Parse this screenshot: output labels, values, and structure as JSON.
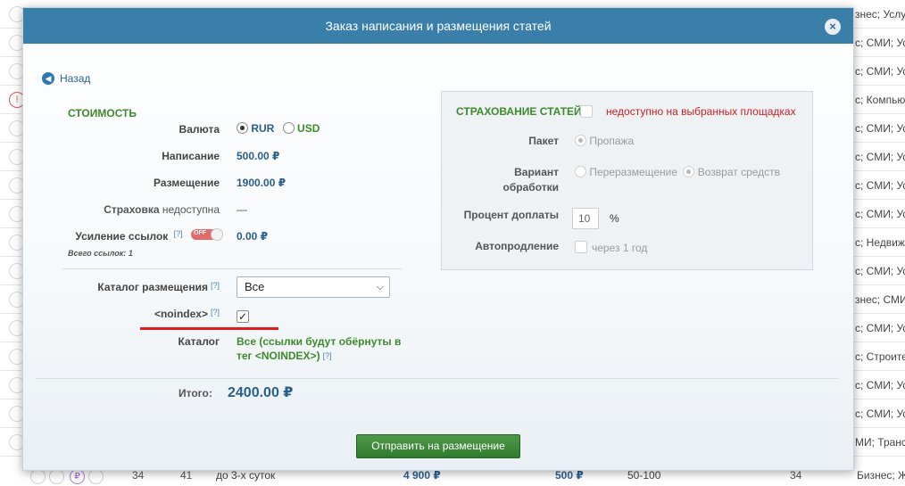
{
  "background": {
    "rows": [
      {
        "right_text": "знес; Услу"
      },
      {
        "right_text": "с; СМИ; Усл"
      },
      {
        "right_text": "с; СМИ; Усл"
      },
      {
        "right_text": "с; Компьюте"
      },
      {
        "right_text": "с; СМИ; Усл"
      },
      {
        "right_text": "с; СМИ; Усл"
      },
      {
        "right_text": "с; СМИ; Усл"
      },
      {
        "right_text": "с; СМИ; Усл"
      },
      {
        "right_text": "с; Недвижи"
      },
      {
        "right_text": "с; СМИ; Усл"
      },
      {
        "right_text": "знес; СМИ"
      },
      {
        "right_text": "с; СМИ; Усл"
      },
      {
        "right_text": "с; Строител"
      },
      {
        "right_text": "с; СМИ; Усл"
      },
      {
        "right_text": "с; СМИ; Усл"
      },
      {
        "right_text": "МИ; Трансп"
      }
    ],
    "last_row": {
      "col1": "34",
      "col2": "41",
      "duration": "до 3-х суток",
      "price1": "4 900 ₽",
      "price2": "500 ₽",
      "range": "50-100",
      "col3": "34",
      "category": "Бизнес; Женский"
    }
  },
  "modal": {
    "title": "Заказ написания и размещения статей",
    "close_icon": "×",
    "back_label": "Назад",
    "cost": {
      "title": "СТОИМОСТЬ",
      "currency_label": "Валюта",
      "currency_rur": "RUR",
      "currency_usd": "USD",
      "writing_label": "Написание",
      "writing_value": "500.00 ₽",
      "placement_label": "Размещение",
      "placement_value": "1900.00 ₽",
      "insurance_label": "Страховка",
      "insurance_status": "недоступна",
      "insurance_value": "—",
      "boost_label": "Усиление ссылок",
      "boost_help": "[?]",
      "boost_toggle": "OFF",
      "boost_value": "0.00 ₽",
      "links_total": "Всего ссылок: 1"
    },
    "catalog": {
      "label": "Каталог размещения",
      "help": "[?]",
      "selected": "Все",
      "noindex_label": "<noindex>",
      "noindex_help": "[?]",
      "noindex_checked": "✓",
      "catalog_label": "Каталог",
      "catalog_value": "Все (ссылки будут обёрнуты в тег <NOINDEX>)",
      "catalog_help": "[?]"
    },
    "total": {
      "label": "Итого:",
      "value": "2400.00 ₽"
    },
    "submit_label": "Отправить на размещение",
    "insurance": {
      "title": "СТРАХОВАНИЕ СТАТЕЙ",
      "unavailable": "недоступно на выбранных площадках",
      "package_label": "Пакет",
      "package_value": "Пропажа",
      "variant_label_1": "Вариант",
      "variant_label_2": "обработки",
      "variant_opt1": "Переразмещение",
      "variant_opt2": "Возврат средств",
      "percent_label": "Процент доплаты",
      "percent_value": "10",
      "percent_unit": "%",
      "autorenew_label": "Автопродление",
      "autorenew_value": "через 1 год"
    }
  }
}
